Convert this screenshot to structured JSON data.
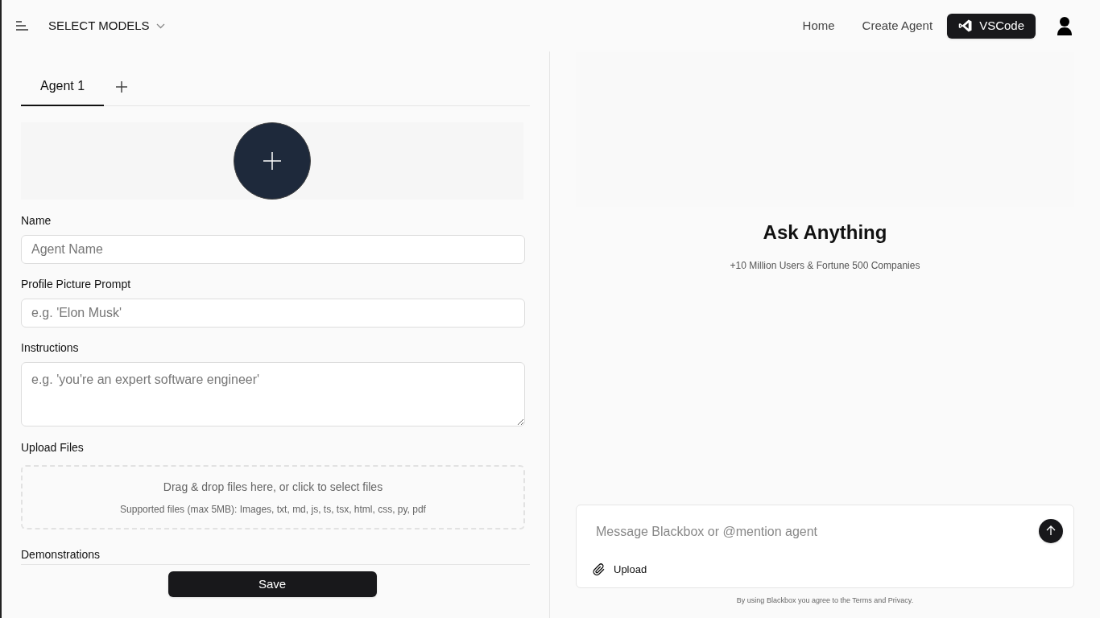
{
  "header": {
    "model_selector": "SELECT MODELS",
    "nav": [
      "Home",
      "Create Agent"
    ],
    "vscode_button": "VSCode"
  },
  "tabs": [
    {
      "label": "Agent 1",
      "selected": true
    }
  ],
  "form": {
    "fields": [
      {
        "label": "Name",
        "placeholder": "Agent Name",
        "kind": "input"
      },
      {
        "label": "Profile Picture Prompt",
        "placeholder": "e.g. 'Elon Musk'",
        "kind": "input"
      },
      {
        "label": "Instructions",
        "placeholder": "e.g. 'you're an expert software engineer'",
        "kind": "textarea"
      }
    ],
    "upload": {
      "label": "Upload Files",
      "prompt": "Drag & drop files here, or click to select files",
      "note": "Supported files (max 5MB): Images, txt, md, js, ts, tsx, html, css, py, pdf"
    },
    "demonstrations_label": "Demonstrations",
    "save_button": "Save"
  },
  "chat": {
    "heading": "Ask Anything",
    "subtitle": "+10 Million Users & Fortune 500 Companies",
    "placeholder": "Message Blackbox or @mention agent",
    "upload_button": "Upload",
    "footer": "By using Blackbox you agree to the Terms and Privacy."
  }
}
